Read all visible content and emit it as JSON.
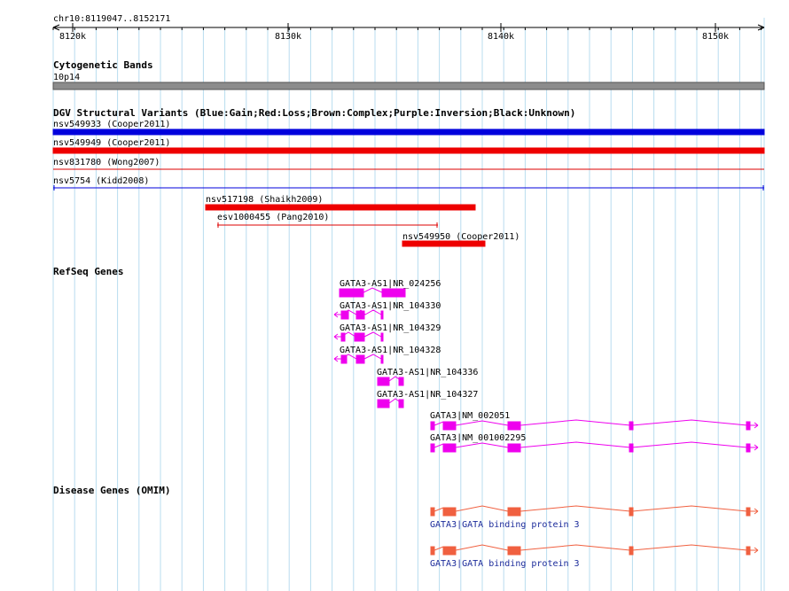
{
  "ruler": {
    "region": "chr10:8119047..8152171",
    "ticks": [
      "8120k",
      "8130k",
      "8140k",
      "8150k"
    ]
  },
  "cytoband": {
    "title": "Cytogenetic Bands",
    "band": "10p14"
  },
  "dgv": {
    "title": "DGV Structural Variants (Blue:Gain;Red:Loss;Brown:Complex;Purple:Inversion;Black:Unknown)",
    "variants": [
      {
        "label": "nsv549933 (Cooper2011)",
        "color": "#0000dd",
        "style": "thick"
      },
      {
        "label": "nsv549949 (Cooper2011)",
        "color": "#ee0000",
        "style": "thick"
      },
      {
        "label": "nsv831780 (Wong2007)",
        "color": "#dd0000",
        "style": "thin"
      },
      {
        "label": "nsv5754 (Kidd2008)",
        "color": "#0000dd",
        "style": "thin-capped"
      },
      {
        "label": "nsv517198 (Shaikh2009)",
        "color": "#ee0000",
        "style": "thick"
      },
      {
        "label": "esv1000455 (Pang2010)",
        "color": "#dd0000",
        "style": "thin-capped"
      },
      {
        "label": "nsv549950 (Cooper2011)",
        "color": "#ee0000",
        "style": "thick"
      }
    ]
  },
  "refseq": {
    "title": "RefSeq Genes",
    "color": "#ee00ee",
    "transcripts": [
      {
        "label": "GATA3-AS1|NR_024256"
      },
      {
        "label": "GATA3-AS1|NR_104330"
      },
      {
        "label": "GATA3-AS1|NR_104329"
      },
      {
        "label": "GATA3-AS1|NR_104328"
      },
      {
        "label": "GATA3-AS1|NR_104336"
      },
      {
        "label": "GATA3-AS1|NR_104327"
      },
      {
        "label": "GATA3|NM_002051"
      },
      {
        "label": "GATA3|NM_001002295"
      }
    ]
  },
  "omim": {
    "title": "Disease Genes (OMIM)",
    "color": "#f06040",
    "genes": [
      {
        "label": "GATA3|GATA binding protein 3"
      },
      {
        "label": "GATA3|GATA binding protein 3"
      }
    ]
  }
}
